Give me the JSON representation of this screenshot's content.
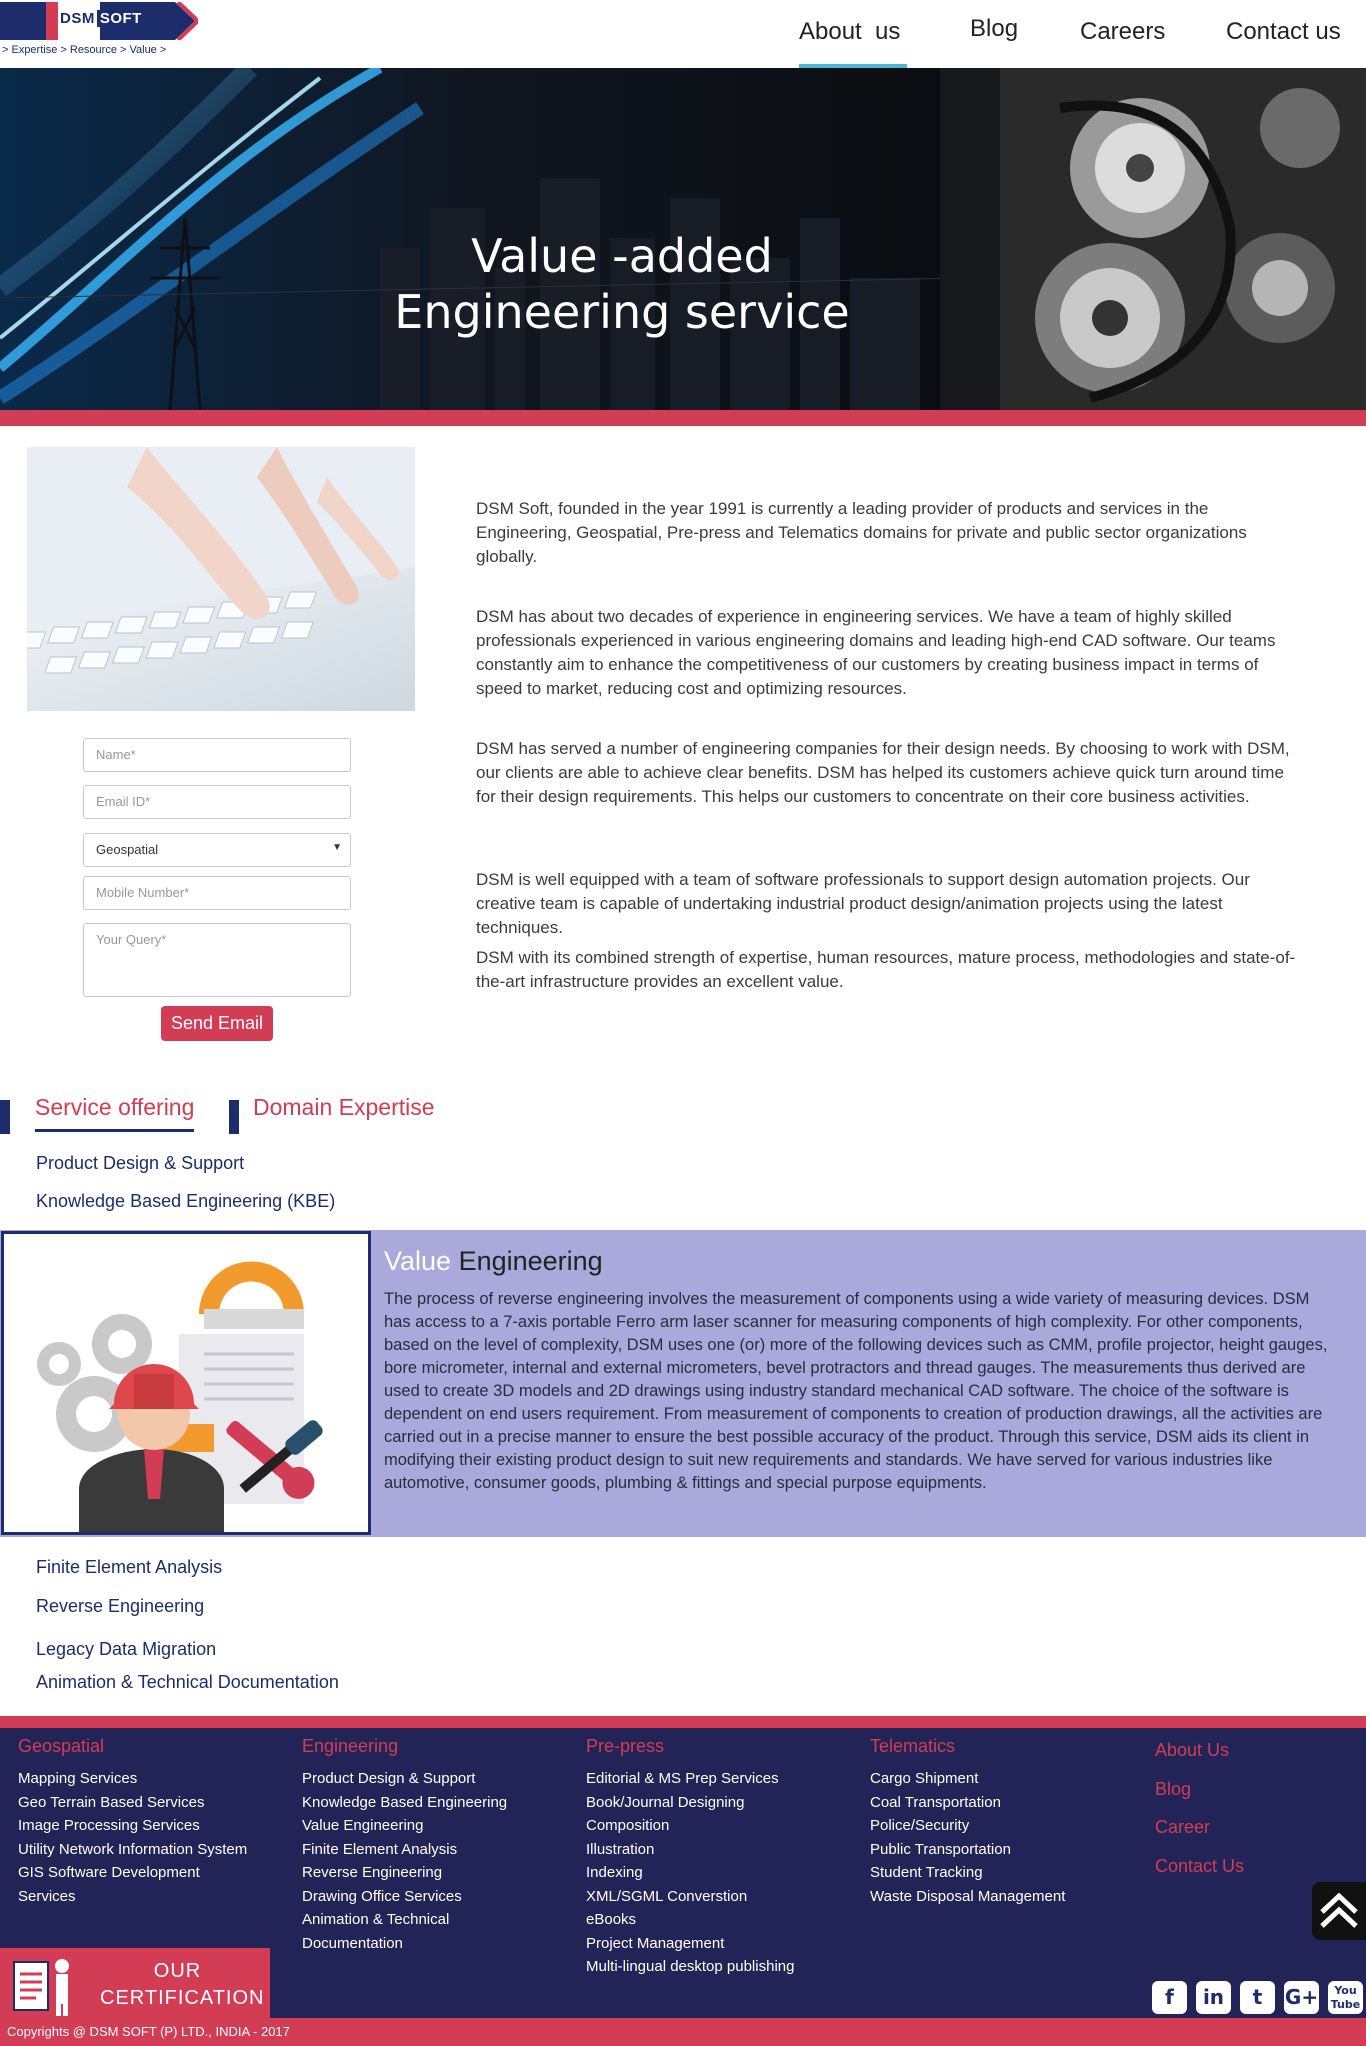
{
  "header": {
    "logo_dsm": "DSM",
    "logo_soft": "SOFT",
    "tagline": "> Expertise > Resource > Value >",
    "nav": {
      "about": "About  us",
      "blog": "Blog",
      "careers": "Careers",
      "contact": "Contact us"
    }
  },
  "hero": {
    "title_line1": "Value -added",
    "title_line2": "Engineering service"
  },
  "form": {
    "name_placeholder": "Name*",
    "email_placeholder": "Email ID*",
    "domain_selected": "Geospatial",
    "mobile_placeholder": "Mobile Number*",
    "query_placeholder": "Your Query*",
    "send_label": "Send Email"
  },
  "about": {
    "p1": "DSM Soft, founded in the year 1991 is currently a leading provider of products and services in the Engineering, Geospatial, Pre-press and Telematics domains for private and public sector organizations globally.",
    "p2": "DSM has about two decades of experience in engineering services. We have a team of highly skilled professionals experienced in various engineering domains and leading high-end CAD software. Our teams constantly aim to enhance the competitiveness of our customers by creating business impact in terms of speed to market, reducing cost and optimizing resources.",
    "p3": "DSM has served a number of engineering companies for their design needs. By choosing to work with DSM, our clients are able to achieve clear benefits. DSM has helped its customers achieve quick turn around time for their design requirements. This helps our customers to concentrate on their core business activities.",
    "p4": "DSM is well equipped with a team of software professionals to support design automation projects. Our creative team is capable of undertaking industrial product design/animation projects using the latest techniques.",
    "p5": "DSM with its combined strength of expertise, human resources, mature process, methodologies and state-of-the-art infrastructure provides an excellent value."
  },
  "tabs": {
    "service": "Service offering",
    "domain": "Domain Expertise"
  },
  "services": {
    "s1": "Product Design & Support",
    "s2": "Knowledge Based Engineering (KBE)",
    "s4": "Finite Element Analysis",
    "s5": "Reverse Engineering",
    "s6": "Legacy Data Migration",
    "s7": "Animation & Technical Documentation"
  },
  "value_engineering": {
    "title_value": "Value",
    "title_rest": " Engineering",
    "text": "The process of reverse engineering involves the measurement of components using a wide variety of measuring devices. DSM has access to a 7-axis portable Ferro arm laser scanner for measuring components of high complexity. For other components, based on the level of complexity, DSM uses one (or) more of the following devices such as CMM, profile projector, height gauges, bore micrometer, internal and external micrometers, bevel protractors and thread gauges. The measurements thus derived are used to create 3D models and 2D drawings using industry standard mechanical CAD software. The choice of the software is dependent on end users requirement. From measurement of components to creation of production drawings, all the activities are carried out in a precise manner to ensure the best possible accuracy of the product. Through this service, DSM aids its client in modifying their existing product design to suit new requirements and standards. We have served for various industries like automotive, consumer goods, plumbing & fittings and special purpose equipments."
  },
  "footer": {
    "geospatial": {
      "title": "Geospatial",
      "items": [
        "Mapping Services",
        "Geo Terrain Based Services",
        "Image Processing Services",
        "Utility Network Information System",
        "GIS Software Development",
        "Services"
      ]
    },
    "engineering": {
      "title": "Engineering",
      "items": [
        "Product Design & Support",
        "Knowledge Based Engineering",
        "Value Engineering",
        "Finite Element Analysis",
        "Reverse Engineering",
        "Drawing Office Services",
        "Animation & Technical",
        "Documentation"
      ]
    },
    "prepress": {
      "title": "Pre-press",
      "items": [
        "Editorial & MS Prep Services",
        "Book/Journal Designing",
        "Composition",
        "Illustration",
        "Indexing",
        "XML/SGML Converstion",
        "eBooks",
        "Project Management",
        "Multi-lingual desktop publishing"
      ]
    },
    "telematics": {
      "title": "Telematics",
      "items": [
        "Cargo Shipment",
        "Coal Transportation",
        "Police/Security",
        "Public Transportation",
        "Student Tracking",
        "Waste Disposal Management"
      ]
    },
    "links": {
      "about": "About Us",
      "blog": "Blog",
      "career": "Career",
      "contact": "Contact Us"
    },
    "certification_line1": "OUR",
    "certification_line2": "CERTIFICATION",
    "copyright": "Copyrights @ DSM SOFT (P) LTD., INDIA - 2017",
    "social": {
      "facebook": "f",
      "linkedin": "in",
      "twitter": "t",
      "googleplus": "G+",
      "youtube": "You Tube"
    }
  },
  "colors": {
    "accent_red": "#d23c55",
    "navy": "#1d2d6b",
    "footer_bg": "#222457",
    "ve_bg": "#a9a9dc",
    "nav_underline": "#4cb7d4"
  }
}
